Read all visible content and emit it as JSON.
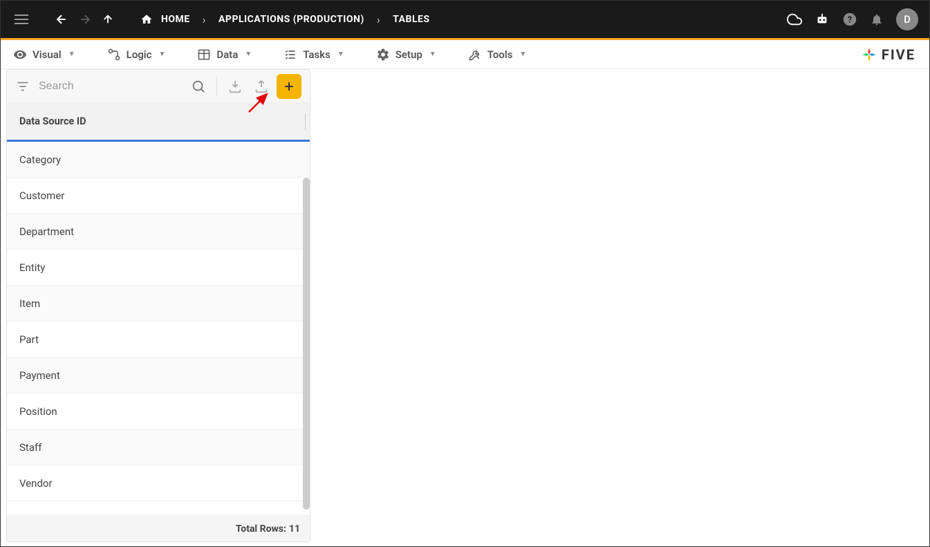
{
  "header": {
    "breadcrumb": [
      "HOME",
      "APPLICATIONS (PRODUCTION)",
      "TABLES"
    ],
    "avatar_initial": "D"
  },
  "menu": {
    "items": [
      {
        "label": "Visual"
      },
      {
        "label": "Logic"
      },
      {
        "label": "Data"
      },
      {
        "label": "Tasks"
      },
      {
        "label": "Setup"
      },
      {
        "label": "Tools"
      }
    ],
    "brand": "FIVE"
  },
  "panel": {
    "search_placeholder": "Search",
    "column_header": "Data Source ID",
    "rows": [
      "Category",
      "Customer",
      "Department",
      "Entity",
      "Item",
      "Part",
      "Payment",
      "Position",
      "Staff",
      "Vendor"
    ],
    "footer_label": "Total Rows:",
    "total_rows": "11"
  }
}
